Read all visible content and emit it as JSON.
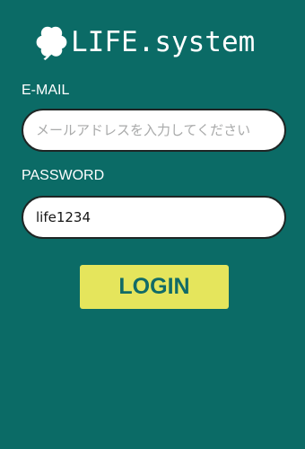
{
  "app": {
    "logo": {
      "icon": "clover-icon",
      "text": "LIFE.system"
    }
  },
  "form": {
    "email": {
      "label": "E-MAIL",
      "value": "",
      "placeholder": "メールアドレスを入力してください"
    },
    "password": {
      "label": "PASSWORD",
      "value": "life1234",
      "placeholder": ""
    },
    "login_button": {
      "label": "LOGIN"
    }
  },
  "colors": {
    "background": "#0b6b66",
    "field_background": "#ffffff",
    "field_border": "#1e2524",
    "placeholder": "#a9aaaa",
    "button_background": "#e5e55c",
    "button_text": "#116b67",
    "text": "#ffffff"
  }
}
